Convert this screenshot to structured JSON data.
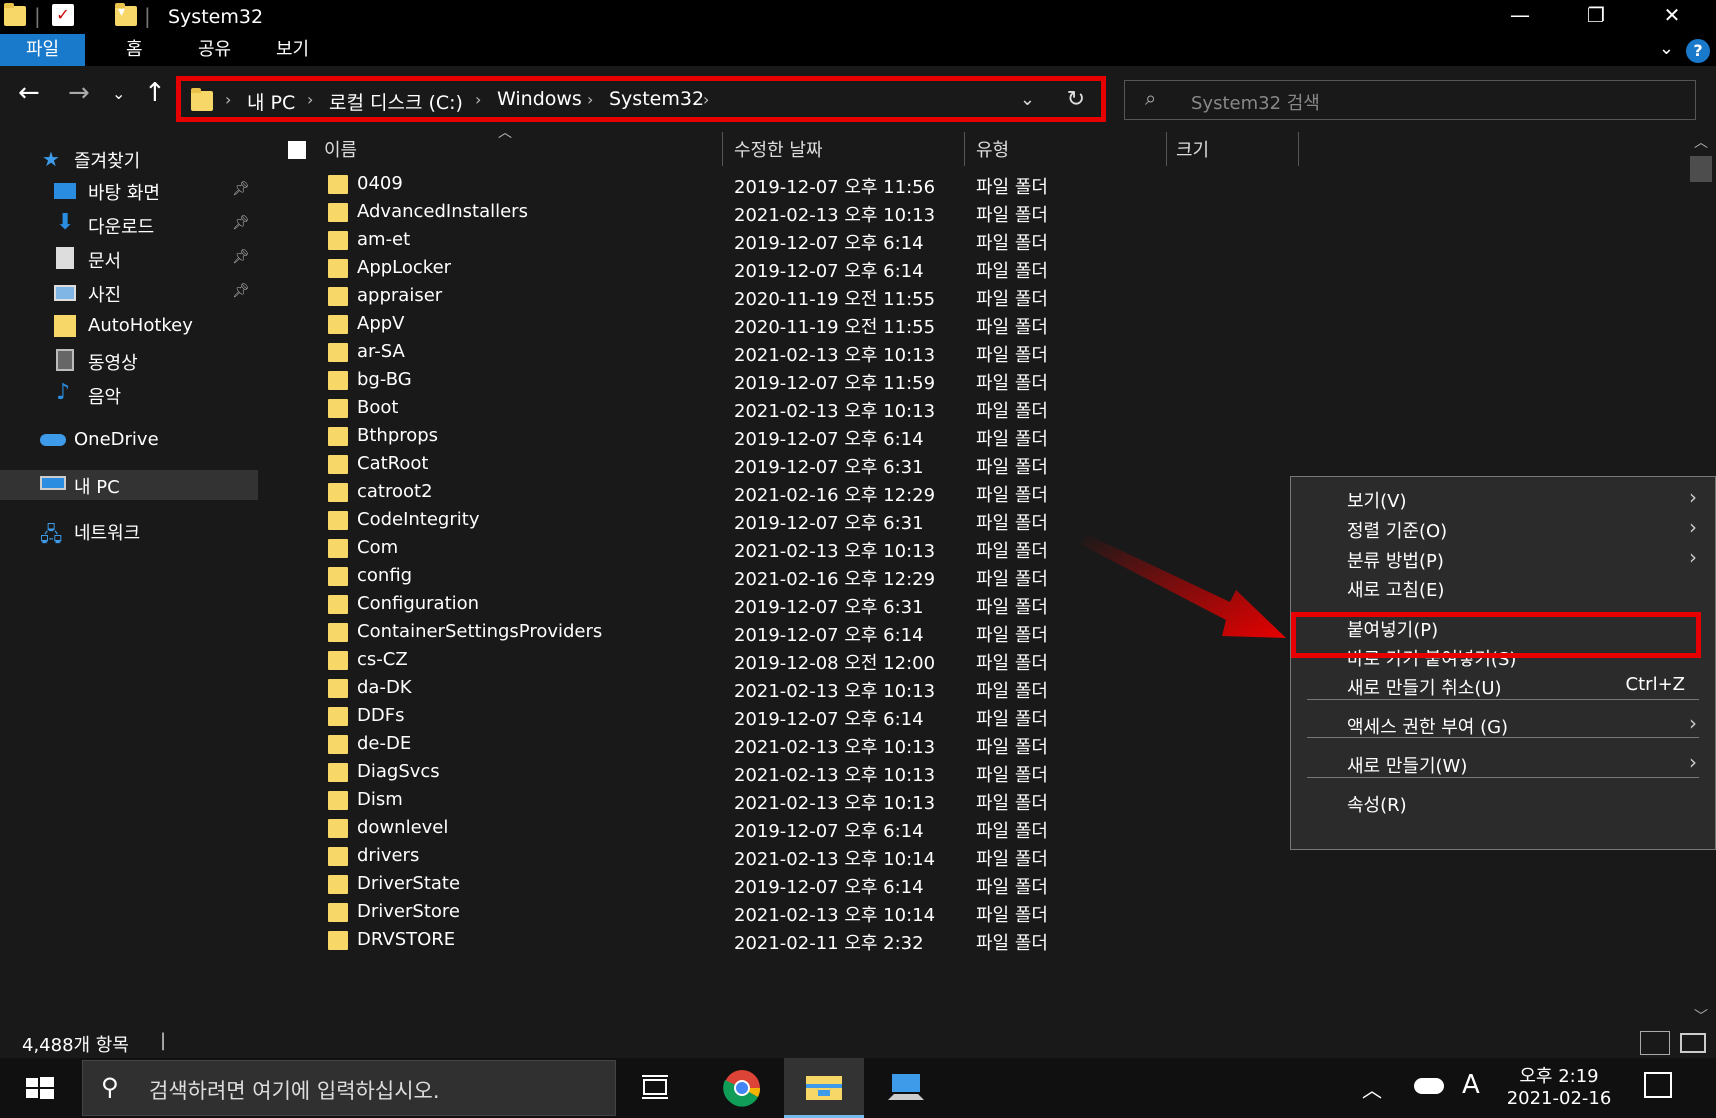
{
  "window": {
    "title": "System32",
    "minimize_glyph": "—",
    "restore_glyph": "❐",
    "close_glyph": "✕"
  },
  "ribbon": {
    "tabs": [
      "파일",
      "홈",
      "공유",
      "보기"
    ],
    "active_tab": "파일",
    "help_glyph": "?"
  },
  "address": {
    "crumbs": [
      "내 PC",
      "로컬 디스크 (C:)",
      "Windows",
      "System32"
    ],
    "separator": "›"
  },
  "search": {
    "placeholder": "System32 검색"
  },
  "sidebar": {
    "quick_access_label": "즐겨찾기",
    "items": [
      {
        "label": "바탕 화면",
        "icon": "desktop-icon",
        "pinned": true
      },
      {
        "label": "다운로드",
        "icon": "download-icon",
        "pinned": true
      },
      {
        "label": "문서",
        "icon": "documents-icon",
        "pinned": true
      },
      {
        "label": "사진",
        "icon": "pictures-icon",
        "pinned": true
      },
      {
        "label": "AutoHotkey",
        "icon": "folder-icon",
        "pinned": false
      },
      {
        "label": "동영상",
        "icon": "videos-icon",
        "pinned": false
      },
      {
        "label": "음악",
        "icon": "music-icon",
        "pinned": false
      }
    ],
    "onedrive_label": "OneDrive",
    "thispc_label": "내 PC",
    "network_label": "네트워크"
  },
  "columns": {
    "name": "이름",
    "modified": "수정한 날짜",
    "type": "유형",
    "size": "크기"
  },
  "files": [
    {
      "name": "0409",
      "modified": "2019-12-07 오후 11:56",
      "type": "파일 폴더"
    },
    {
      "name": "AdvancedInstallers",
      "modified": "2021-02-13 오후 10:13",
      "type": "파일 폴더"
    },
    {
      "name": "am-et",
      "modified": "2019-12-07 오후 6:14",
      "type": "파일 폴더"
    },
    {
      "name": "AppLocker",
      "modified": "2019-12-07 오후 6:14",
      "type": "파일 폴더"
    },
    {
      "name": "appraiser",
      "modified": "2020-11-19 오전 11:55",
      "type": "파일 폴더"
    },
    {
      "name": "AppV",
      "modified": "2020-11-19 오전 11:55",
      "type": "파일 폴더"
    },
    {
      "name": "ar-SA",
      "modified": "2021-02-13 오후 10:13",
      "type": "파일 폴더"
    },
    {
      "name": "bg-BG",
      "modified": "2019-12-07 오후 11:59",
      "type": "파일 폴더"
    },
    {
      "name": "Boot",
      "modified": "2021-02-13 오후 10:13",
      "type": "파일 폴더"
    },
    {
      "name": "Bthprops",
      "modified": "2019-12-07 오후 6:14",
      "type": "파일 폴더"
    },
    {
      "name": "CatRoot",
      "modified": "2019-12-07 오후 6:31",
      "type": "파일 폴더"
    },
    {
      "name": "catroot2",
      "modified": "2021-02-16 오후 12:29",
      "type": "파일 폴더"
    },
    {
      "name": "CodeIntegrity",
      "modified": "2019-12-07 오후 6:31",
      "type": "파일 폴더"
    },
    {
      "name": "Com",
      "modified": "2021-02-13 오후 10:13",
      "type": "파일 폴더"
    },
    {
      "name": "config",
      "modified": "2021-02-16 오후 12:29",
      "type": "파일 폴더"
    },
    {
      "name": "Configuration",
      "modified": "2019-12-07 오후 6:31",
      "type": "파일 폴더"
    },
    {
      "name": "ContainerSettingsProviders",
      "modified": "2019-12-07 오후 6:14",
      "type": "파일 폴더"
    },
    {
      "name": "cs-CZ",
      "modified": "2019-12-08 오전 12:00",
      "type": "파일 폴더"
    },
    {
      "name": "da-DK",
      "modified": "2021-02-13 오후 10:13",
      "type": "파일 폴더"
    },
    {
      "name": "DDFs",
      "modified": "2019-12-07 오후 6:14",
      "type": "파일 폴더"
    },
    {
      "name": "de-DE",
      "modified": "2021-02-13 오후 10:13",
      "type": "파일 폴더"
    },
    {
      "name": "DiagSvcs",
      "modified": "2021-02-13 오후 10:13",
      "type": "파일 폴더"
    },
    {
      "name": "Dism",
      "modified": "2021-02-13 오후 10:13",
      "type": "파일 폴더"
    },
    {
      "name": "downlevel",
      "modified": "2019-12-07 오후 6:14",
      "type": "파일 폴더"
    },
    {
      "name": "drivers",
      "modified": "2021-02-13 오후 10:14",
      "type": "파일 폴더"
    },
    {
      "name": "DriverState",
      "modified": "2019-12-07 오후 6:14",
      "type": "파일 폴더"
    },
    {
      "name": "DriverStore",
      "modified": "2021-02-13 오후 10:14",
      "type": "파일 폴더"
    },
    {
      "name": "DRVSTORE",
      "modified": "2021-02-11 오후 2:32",
      "type": "파일 폴더"
    }
  ],
  "status": {
    "item_count": "4,488개 항목"
  },
  "context_menu": {
    "items": [
      {
        "label": "보기(V)",
        "submenu": true,
        "shortcut": ""
      },
      {
        "label": "정렬 기준(O)",
        "submenu": true,
        "shortcut": ""
      },
      {
        "label": "분류 방법(P)",
        "submenu": true,
        "shortcut": ""
      },
      {
        "label": "새로 고침(E)",
        "submenu": false,
        "shortcut": ""
      },
      {
        "label": "붙여넣기(P)",
        "submenu": false,
        "shortcut": "",
        "highlighted": true
      },
      {
        "label": "바로 가기 붙여넣기(S)",
        "submenu": false,
        "shortcut": ""
      },
      {
        "label": "새로 만들기 취소(U)",
        "submenu": false,
        "shortcut": "Ctrl+Z"
      },
      {
        "label": "액세스 권한 부여 (G)",
        "submenu": true,
        "shortcut": ""
      },
      {
        "label": "새로 만들기(W)",
        "submenu": true,
        "shortcut": ""
      },
      {
        "label": "속성(R)",
        "submenu": false,
        "shortcut": ""
      }
    ]
  },
  "taskbar": {
    "search_placeholder": "검색하려면 여기에 입력하십시오.",
    "ime_indicator": "A",
    "time": "오후 2:19",
    "date": "2021-02-16"
  },
  "colors": {
    "accent": "#1979ca",
    "annotation_red": "#e60000",
    "folder": "#f7d767",
    "background": "#191919"
  }
}
